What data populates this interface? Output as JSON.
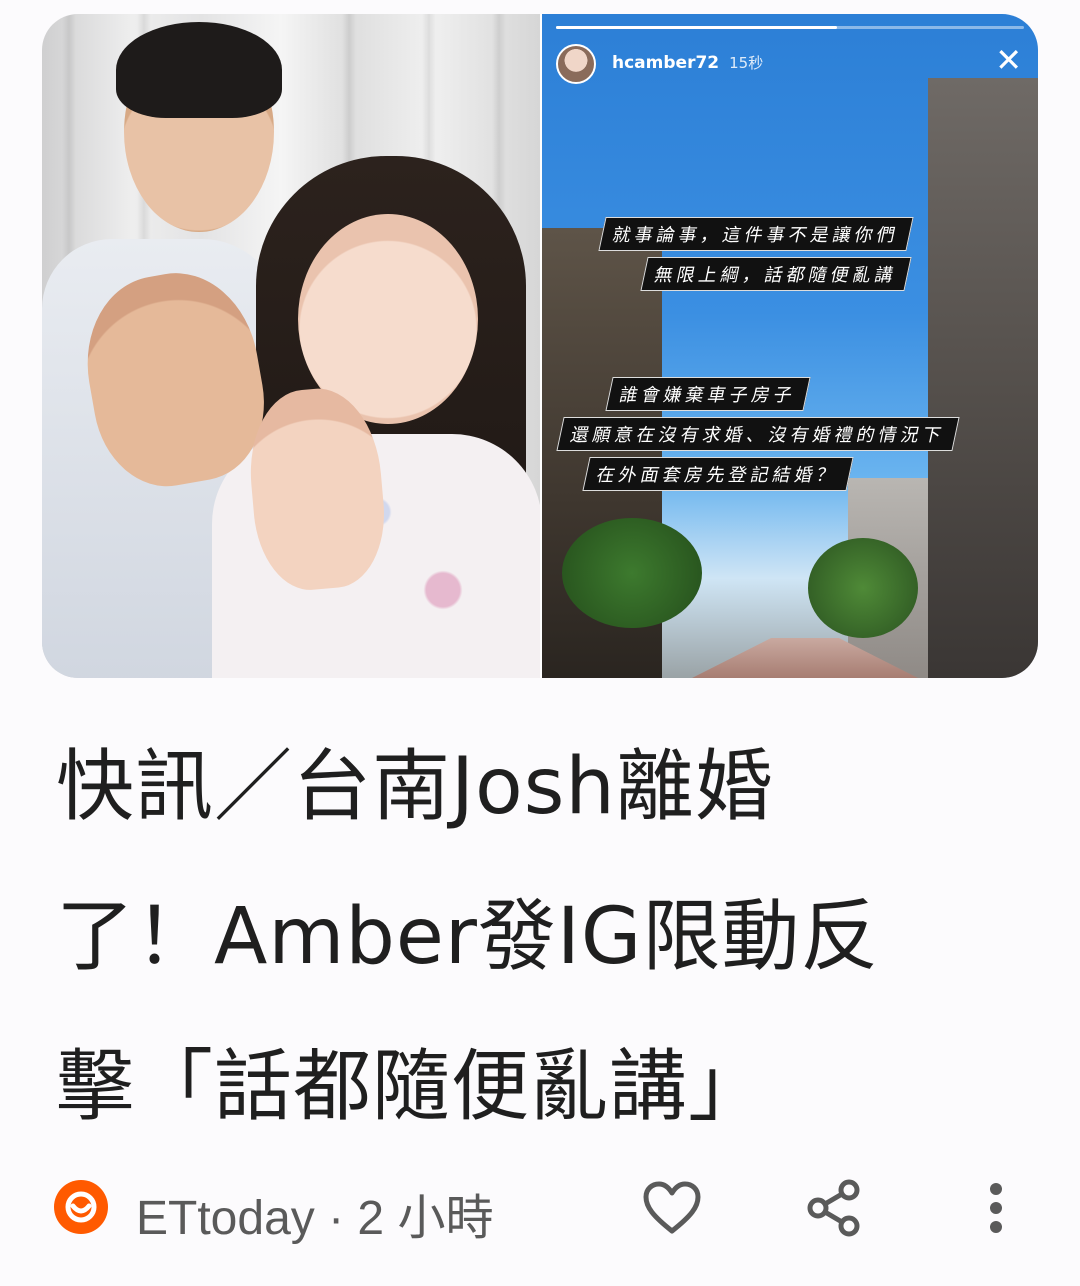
{
  "story_overlay": {
    "username": "hcamber72",
    "time": "15秒",
    "close_glyph": "✕",
    "caption_top": [
      "就事論事，這件事不是讓你們",
      "無限上綱，話都隨便亂講"
    ],
    "caption_bottom": [
      "誰會嫌棄車子房子",
      "還願意在沒有求婚、沒有婚禮的情況下",
      "在外面套房先登記結婚？"
    ]
  },
  "article": {
    "headline_lines": [
      "快訊／台南Josh離婚",
      "了！Amber發IG限動反",
      "擊「話都隨便亂講」"
    ]
  },
  "meta": {
    "source": "ETtoday",
    "separator": " · ",
    "age": "2 小時"
  },
  "colors": {
    "source_logo": "#ff5a00",
    "text_primary": "#1f1f1f",
    "text_secondary": "#5a5a5a",
    "icon": "#5a5a5a"
  },
  "icons": {
    "source": "ettoday-logo-icon",
    "like": "heart-icon",
    "share": "share-icon",
    "more": "more-vert-icon"
  }
}
